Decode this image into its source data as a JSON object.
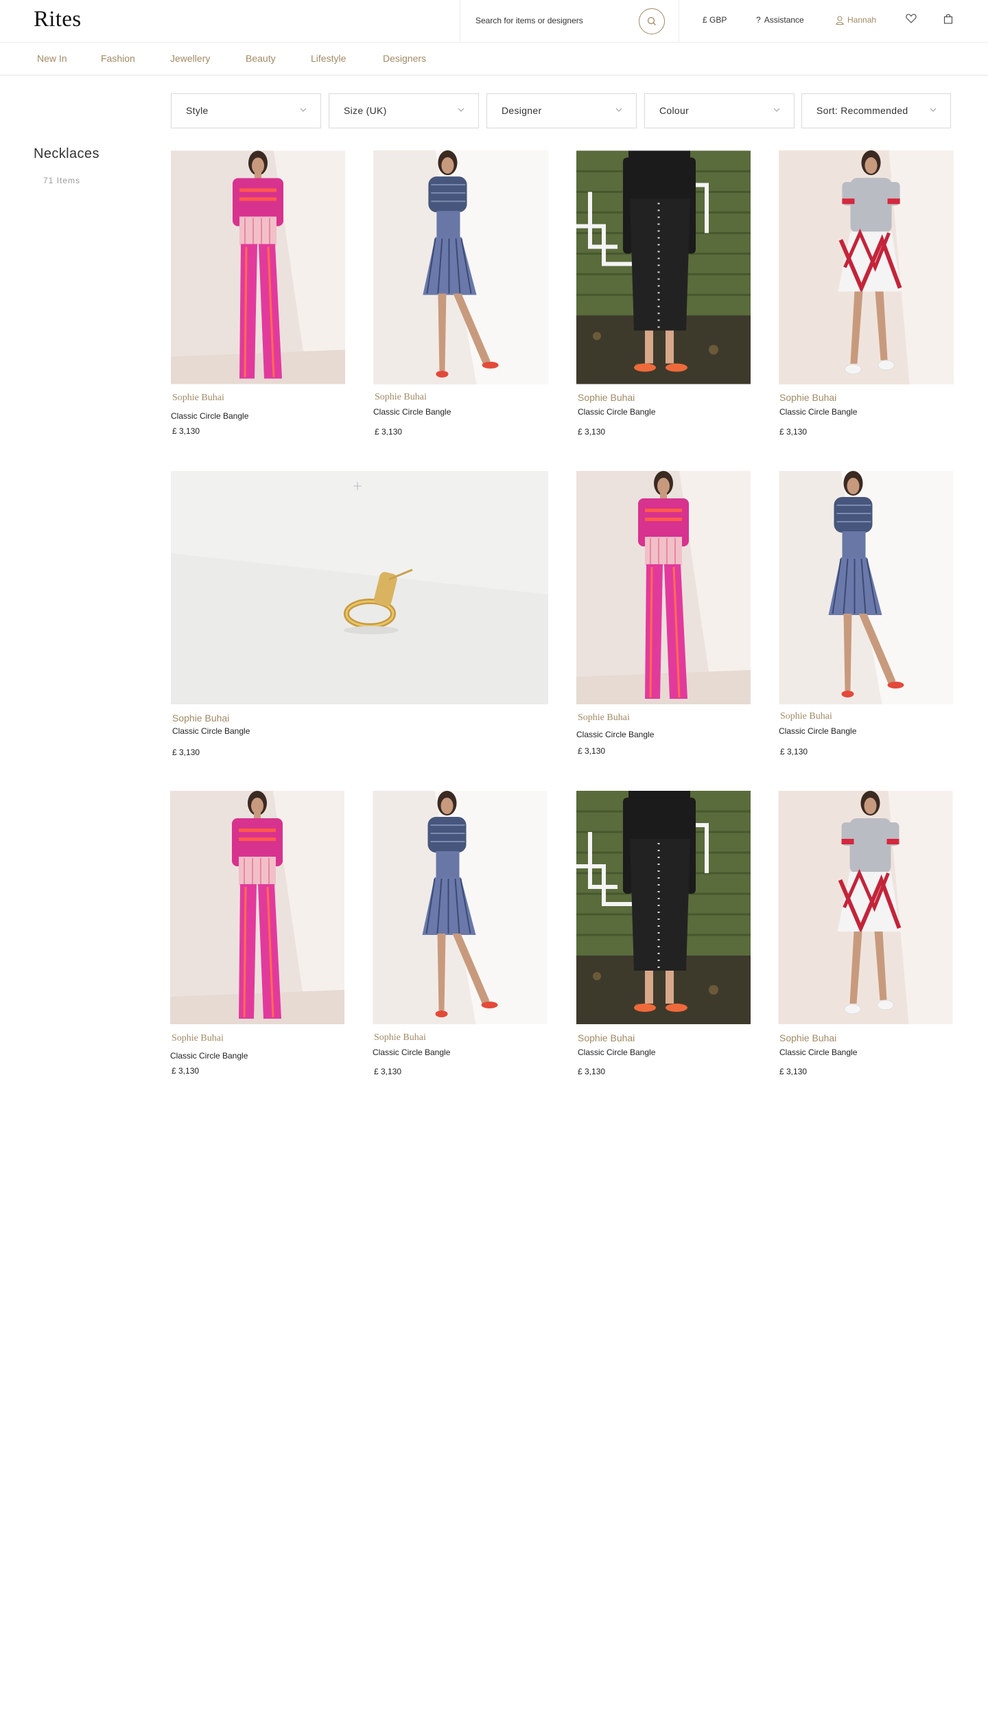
{
  "brand": {
    "logo": "Rites"
  },
  "header": {
    "search_placeholder": "Search for items or designers",
    "currency": "£ GBP",
    "assistance": "Assistance",
    "account_name": "Hannah"
  },
  "nav": {
    "items": [
      "New In",
      "Fashion",
      "Jewellery",
      "Beauty",
      "Lifestyle",
      "Designers"
    ]
  },
  "sidebar": {
    "category_title": "Necklaces",
    "item_count": "71 Items"
  },
  "filters": [
    "Style",
    "Size (UK)",
    "Designer",
    "Colour",
    "Sort: Recommended"
  ],
  "products": [
    {
      "designer": "Sophie Buhai",
      "name": "Classic Circle Bangle",
      "price": "£ 3,130"
    },
    {
      "designer": "Sophie Buhai",
      "name": "Classic Circle Bangle",
      "price": "£ 3,130"
    },
    {
      "designer": "Sophie Buhai",
      "name": "Classic Circle Bangle",
      "price": "£ 3,130"
    },
    {
      "designer": "Sophie Buhai",
      "name": "Classic Circle Bangle",
      "price": "£ 3,130"
    },
    {
      "designer": "Sophie Buhai",
      "name": "Classic Circle Bangle",
      "price": "£ 3,130"
    },
    {
      "designer": "Sophie Buhai",
      "name": "Classic Circle Bangle",
      "price": "£ 3,130"
    },
    {
      "designer": "Sophie Buhai",
      "name": "Classic Circle Bangle",
      "price": "£ 3,130"
    },
    {
      "designer": "Sophie Buhai",
      "name": "Classic Circle Bangle",
      "price": "£ 3,130"
    },
    {
      "designer": "Sophie Buhai",
      "name": "Classic Circle Bangle",
      "price": "£ 3,130"
    },
    {
      "designer": "Sophie Buhai",
      "name": "Classic Circle Bangle",
      "price": "£ 3,130"
    },
    {
      "designer": "Sophie Buhai",
      "name": "Classic Circle Bangle",
      "price": "£ 3,130"
    }
  ],
  "colors": {
    "accent": "#a18a64",
    "border": "#dadada",
    "text": "#333333"
  }
}
